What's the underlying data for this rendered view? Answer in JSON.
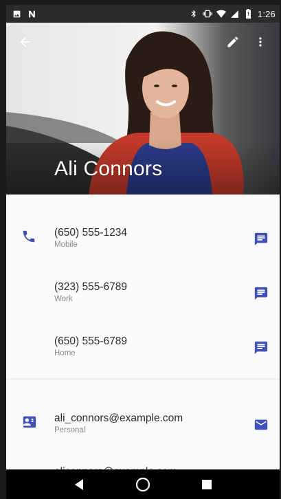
{
  "statusbar": {
    "time": "1:26",
    "icons_left": [
      "image-icon",
      "n-notification-icon"
    ],
    "icons_right": [
      "bluetooth-icon",
      "vibrate-icon",
      "wifi-icon",
      "cell-signal-icon",
      "battery-icon"
    ]
  },
  "appbar": {
    "back_icon": "arrow-back-icon",
    "edit_icon": "pencil-icon",
    "overflow_icon": "more-vert-icon"
  },
  "contact": {
    "name": "Ali Connors"
  },
  "phones": [
    {
      "number": "(650) 555-1234",
      "type": "Mobile"
    },
    {
      "number": "(323) 555-6789",
      "type": "Work"
    },
    {
      "number": "(650) 555-6789",
      "type": "Home"
    }
  ],
  "emails": [
    {
      "address": "ali_connors@example.com",
      "type": "Personal"
    },
    {
      "address": "aliconnors@example.com",
      "type": ""
    }
  ],
  "colors": {
    "accent": "#3f51b5",
    "status_bar": "#2b2b2b",
    "nav_bar": "#000000",
    "primary_text": "#2b2b2b",
    "secondary_text": "#8a8a8a"
  }
}
